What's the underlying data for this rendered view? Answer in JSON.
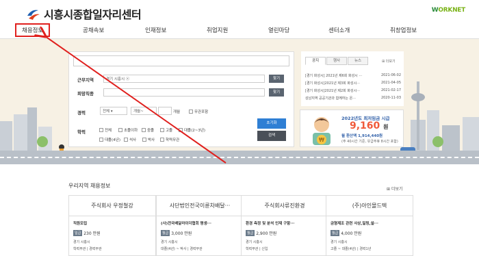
{
  "header": {
    "logo_text": "시흥시종합일자리센터",
    "worknet_a": "W",
    "worknet_b": "ORKNET"
  },
  "nav": [
    "채용정보",
    "공채속보",
    "인재정보",
    "취업지원",
    "열린마당",
    "센터소개",
    "취창업정보"
  ],
  "search": {
    "region_label": "근무지역",
    "region_value": "경기 시흥시 ⓧ",
    "find_label": "찾기",
    "job_label": "희망직종",
    "find2_label": "찾기",
    "career_label": "경력",
    "career_select": "전체",
    "career_min": "개월~",
    "career_max": "개월",
    "career_none": "무관포함",
    "edu_label": "학력",
    "edu": [
      "전체",
      "초졸이하",
      "중졸",
      "고졸",
      "대졸(2~3년)",
      "대졸(4년)",
      "석사",
      "박사",
      "학력무관"
    ],
    "reset_btn": "초기화",
    "search_btn": "검색"
  },
  "notice": {
    "tabs": [
      "공지",
      "행사",
      "뉴스"
    ],
    "more": "더보기",
    "rows": [
      {
        "title": "[경기 화성시] 2021년 제6회 화성시 ···",
        "date": "2021-06-02"
      },
      {
        "title": "[경기 화성시]2021년 제3회 화성시···",
        "date": "2021-04-05"
      },
      {
        "title": "[경기 화성시]2021년 제2회 화성시···",
        "date": "2021-02-17"
      },
      {
        "title": "성남지역 공공기관과 함께하는 온···",
        "date": "2020-11-03"
      }
    ]
  },
  "banner": {
    "title": "2022년도 최저임금 시급",
    "amount": "9,160",
    "unit": "원",
    "monthly": "월 환산액 1,914,440원",
    "note": "(주 40시간 기준, 유급주휴 8시간 포함)"
  },
  "section": {
    "title": "우리지역 채용정보",
    "more": "더보기"
  },
  "cards": [
    {
      "company": "주식회사 우정철강",
      "job": "직원모집",
      "pay_tag": "일급",
      "pay": "230 만원",
      "loc": "경기 시흥시",
      "cond": "학력무관 | 경력무관"
    },
    {
      "company": "사단법인전국이륜차배달···",
      "job": "(사)전국배달라이더협회 평생···",
      "pay_tag": "월급",
      "pay": "3,000 만원",
      "loc": "경기 시흥시",
      "cond": "대졸(4년) ~ 박사 | 경력무관"
    },
    {
      "company": "주식회사류진환경",
      "job": "환경 측정 및 분석 인재 구함···",
      "pay_tag": "월급",
      "pay": "2,900 만원",
      "loc": "경기 시흥시",
      "cond": "학력무관 | 신입"
    },
    {
      "company": "(주)아인몰드텍",
      "job": "금형제조 관련 사상,밀링,설···",
      "pay_tag": "월급",
      "pay": "4,000 만원",
      "loc": "경기 시흥시",
      "cond": "고졸 ~ 대졸(4년) | 경력1년"
    }
  ],
  "colors": {
    "accent": "#e0201e",
    "primary": "#2f7fd4",
    "hero_bg": "#f7f1e4"
  }
}
